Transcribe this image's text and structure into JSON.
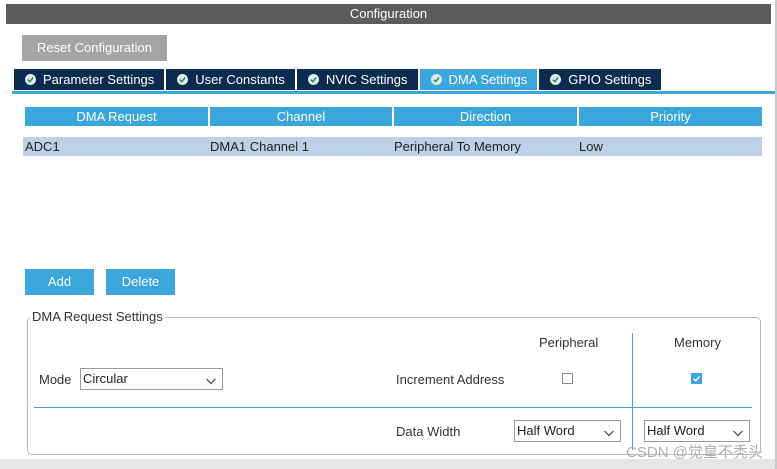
{
  "window": {
    "title": "Configuration"
  },
  "toolbar": {
    "reset_label": "Reset Configuration"
  },
  "tabs": [
    {
      "label": "Parameter Settings",
      "active": false
    },
    {
      "label": "User Constants",
      "active": false
    },
    {
      "label": "NVIC Settings",
      "active": false
    },
    {
      "label": "DMA Settings",
      "active": true
    },
    {
      "label": "GPIO Settings",
      "active": false
    }
  ],
  "table": {
    "headers": [
      "DMA Request",
      "Channel",
      "Direction",
      "Priority"
    ],
    "rows": [
      [
        "ADC1",
        "DMA1 Channel 1",
        "Peripheral To Memory",
        "Low"
      ]
    ]
  },
  "actions": {
    "add_label": "Add",
    "delete_label": "Delete"
  },
  "request_settings": {
    "legend": "DMA Request Settings",
    "mode_label": "Mode",
    "mode_value": "Circular",
    "peripheral_header": "Peripheral",
    "memory_header": "Memory",
    "increment_label": "Increment Address",
    "increment_peripheral": false,
    "increment_memory": true,
    "data_width_label": "Data Width",
    "peripheral_width": "Half Word",
    "memory_width": "Half Word"
  },
  "watermark": "CSDN @觉皇不秃头",
  "colors": {
    "accent": "#3aa6dc",
    "tab_dark": "#0d2b4e",
    "row_selected": "#bcd0e6",
    "titlebar": "#5c5c5c"
  }
}
